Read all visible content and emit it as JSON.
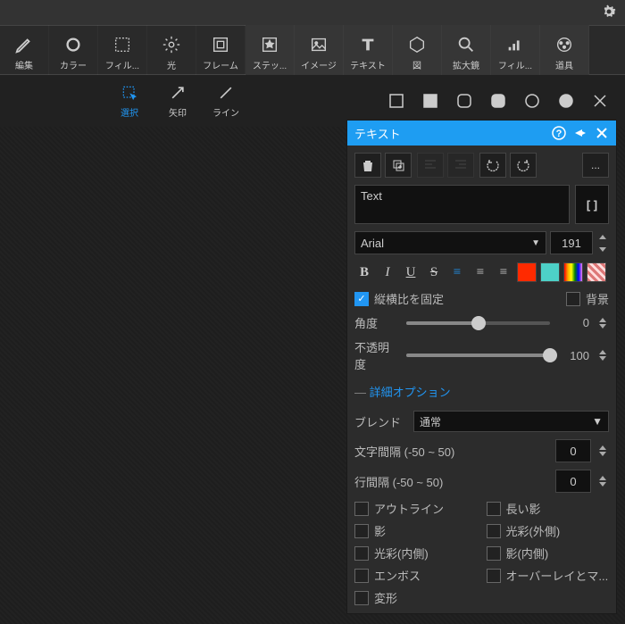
{
  "mainTools": [
    {
      "id": "edit",
      "label": "編集"
    },
    {
      "id": "color",
      "label": "カラー"
    },
    {
      "id": "filter",
      "label": "フィル..."
    },
    {
      "id": "light",
      "label": "光"
    },
    {
      "id": "frame",
      "label": "フレーム"
    },
    {
      "id": "sticker",
      "label": "ステッ..."
    },
    {
      "id": "image",
      "label": "イメージ"
    },
    {
      "id": "text",
      "label": "テキスト"
    },
    {
      "id": "shape",
      "label": "図"
    },
    {
      "id": "magnifier",
      "label": "拡大鏡"
    },
    {
      "id": "filter2",
      "label": "フィル..."
    },
    {
      "id": "tools",
      "label": "道具"
    }
  ],
  "subTools": [
    {
      "id": "select",
      "label": "選択",
      "active": true
    },
    {
      "id": "arrow",
      "label": "矢印"
    },
    {
      "id": "line",
      "label": "ライン"
    }
  ],
  "panel": {
    "title": "テキスト",
    "textValue": "Text",
    "bracket": "[  ]",
    "font": "Arial",
    "fontSize": "191",
    "lockAspect": "縦横比を固定",
    "bgLabel": "背景",
    "angleLabel": "角度",
    "angleValue": "0",
    "opacityLabel": "不透明度",
    "opacityValue": "100",
    "advanced": "詳細オプション",
    "blendLabel": "ブレンド",
    "blendValue": "通常",
    "letterSpacing": "文字間隔 (-50 ~ 50)",
    "letterSpacingVal": "0",
    "lineSpacing": "行間隔 (-50 ~ 50)",
    "lineSpacingVal": "0",
    "opts": {
      "outline": "アウトライン",
      "longShadow": "長い影",
      "shadow": "影",
      "glowOuter": "光彩(外側)",
      "glowInner": "光彩(内側)",
      "shadowInner": "影(内側)",
      "emboss": "エンボス",
      "overlay": "オーバーレイとマ...",
      "transform": "変形"
    }
  }
}
